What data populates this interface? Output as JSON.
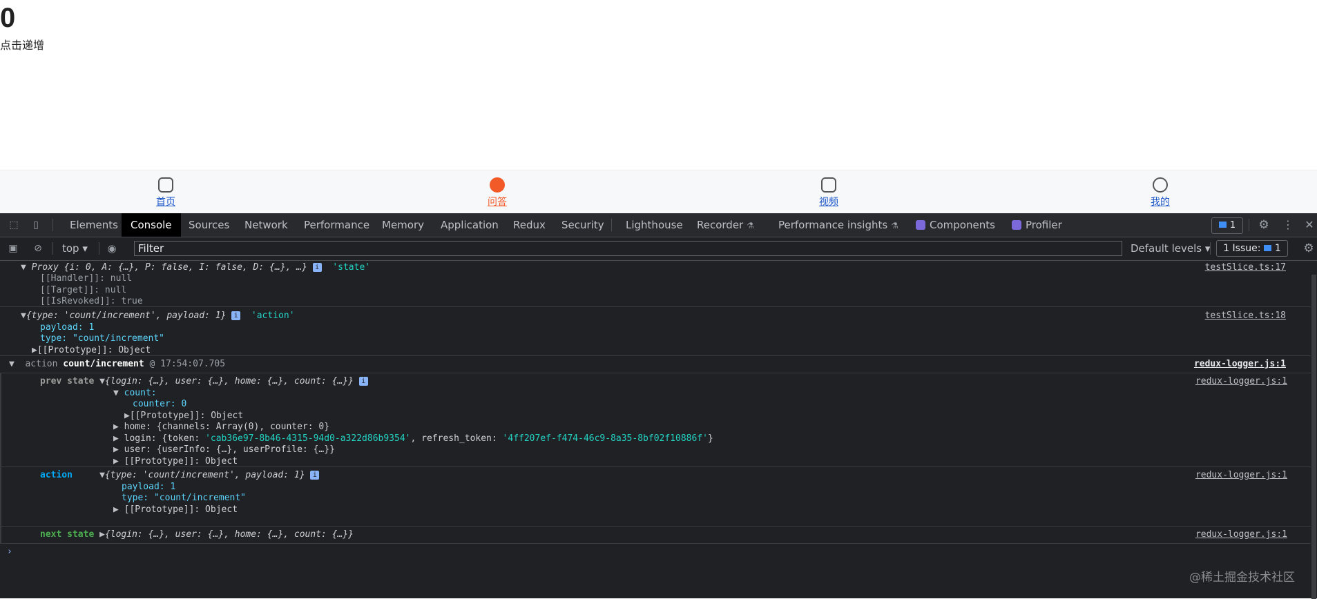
{
  "app": {
    "count": "0",
    "increment_label": "点击递增",
    "tabs": [
      {
        "label": "首页",
        "icon": "home-icon",
        "active": false
      },
      {
        "label": "问答",
        "icon": "qa-icon",
        "active": true
      },
      {
        "label": "视频",
        "icon": "video-icon",
        "active": false
      },
      {
        "label": "我的",
        "icon": "profile-icon",
        "active": false
      }
    ]
  },
  "devtools": {
    "tabs": [
      "Elements",
      "Console",
      "Sources",
      "Network",
      "Performance",
      "Memory",
      "Application",
      "Redux",
      "Security",
      "Lighthouse",
      "Recorder",
      "Performance insights",
      "Components",
      "Profiler"
    ],
    "active_tab": "Console",
    "message_badge": "1",
    "toolbar": {
      "context": "top",
      "filter_placeholder": "Filter",
      "levels": "Default levels",
      "issues": "1 Issue:",
      "issues_count": "1"
    }
  },
  "console": {
    "e1": {
      "l1_a": "Proxy",
      "l1_b": "{i: 0, A: {…}, P: false, I: false, D: {…}, …}",
      "l1_tag": "'state'",
      "handler": "[[Handler]]: null",
      "target": "[[Target]]: null",
      "revoked": "[[IsRevoked]]: true",
      "source": "testSlice.ts:17"
    },
    "e2": {
      "l1": "{type: 'count/increment', payload: 1}",
      "l1_tag": "'action'",
      "payload": "payload: 1",
      "type": "type: \"count/increment\"",
      "proto": "[[Prototype]]: Object",
      "source": "testSlice.ts:18"
    },
    "group": {
      "action_word": "action",
      "name": "count/increment",
      "time": "@ 17:54:07.705",
      "source": "redux-logger.js:1"
    },
    "prev": {
      "label": "prev state",
      "summary": "{login: {…}, user: {…}, home: {…}, count: {…}}",
      "count_key": "count:",
      "counter": "counter: 0",
      "count_proto": "[[Prototype]]: Object",
      "home": "home: {channels: Array(0), counter: 0}",
      "login_a": "login: {token: ",
      "login_token": "'cab36e97-8b46-4315-94d0-a322d86b9354'",
      "login_b": ", refresh_token: ",
      "login_refresh": "'4ff207ef-f474-46c9-8a35-8bf02f10886f'",
      "login_c": "}",
      "user": "user: {userInfo: {…}, userProfile: {…}}",
      "proto": "[[Prototype]]: Object",
      "source": "redux-logger.js:1"
    },
    "action": {
      "label": "action",
      "summary": "{type: 'count/increment', payload: 1}",
      "payload": "payload: 1",
      "type": "type: \"count/increment\"",
      "proto": "[[Prototype]]: Object",
      "source": "redux-logger.js:1"
    },
    "next": {
      "label": "next state",
      "summary": "{login: {…}, user: {…}, home: {…}, count: {…}}",
      "source": "redux-logger.js:1"
    }
  },
  "watermark": "@稀土掘金技术社区"
}
